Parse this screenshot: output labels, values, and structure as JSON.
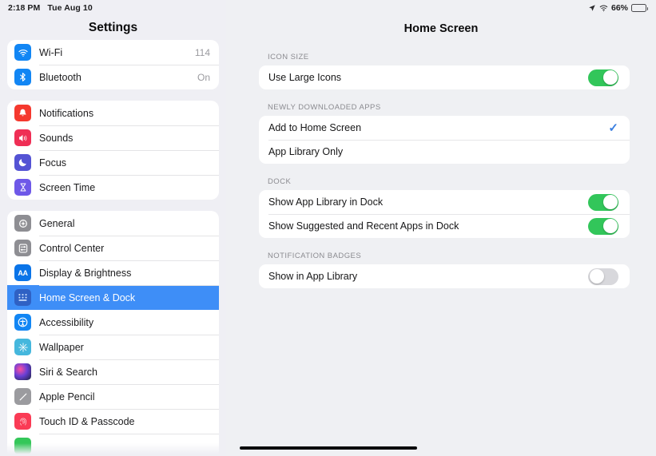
{
  "status_bar": {
    "time": "2:18 PM",
    "date": "Tue Aug 10",
    "battery_percent": "66%",
    "battery_level": 66,
    "charging": true,
    "location_icon": "location-arrow-icon",
    "wifi_icon": "wifi-icon",
    "battery_icon": "battery-charging-icon"
  },
  "sidebar": {
    "title": "Settings",
    "groups": [
      {
        "items": [
          {
            "label": "Wi-Fi",
            "value": "114",
            "icon": "wifi-icon",
            "selected": false
          },
          {
            "label": "Bluetooth",
            "value": "On",
            "icon": "bluetooth-icon",
            "selected": false
          }
        ]
      },
      {
        "items": [
          {
            "label": "Notifications",
            "value": "",
            "icon": "bell-icon",
            "selected": false
          },
          {
            "label": "Sounds",
            "value": "",
            "icon": "speaker-icon",
            "selected": false
          },
          {
            "label": "Focus",
            "value": "",
            "icon": "moon-icon",
            "selected": false
          },
          {
            "label": "Screen Time",
            "value": "",
            "icon": "hourglass-icon",
            "selected": false
          }
        ]
      },
      {
        "items": [
          {
            "label": "General",
            "value": "",
            "icon": "gear-icon",
            "selected": false
          },
          {
            "label": "Control Center",
            "value": "",
            "icon": "sliders-icon",
            "selected": false
          },
          {
            "label": "Display & Brightness",
            "value": "",
            "icon": "aa-text-icon",
            "selected": false
          },
          {
            "label": "Home Screen & Dock",
            "value": "",
            "icon": "app-grid-icon",
            "selected": true
          },
          {
            "label": "Accessibility",
            "value": "",
            "icon": "accessibility-icon",
            "selected": false
          },
          {
            "label": "Wallpaper",
            "value": "",
            "icon": "flower-icon",
            "selected": false
          },
          {
            "label": "Siri & Search",
            "value": "",
            "icon": "siri-orb-icon",
            "selected": false
          },
          {
            "label": "Apple Pencil",
            "value": "",
            "icon": "pencil-icon",
            "selected": false
          },
          {
            "label": "Touch ID & Passcode",
            "value": "",
            "icon": "fingerprint-icon",
            "selected": false
          }
        ]
      }
    ]
  },
  "main": {
    "title": "Home Screen",
    "sections": [
      {
        "header": "ICON SIZE",
        "rows": [
          {
            "label": "Use Large Icons",
            "control": "toggle",
            "state": "on"
          }
        ]
      },
      {
        "header": "NEWLY DOWNLOADED APPS",
        "rows": [
          {
            "label": "Add to Home Screen",
            "control": "check",
            "state": "checked"
          },
          {
            "label": "App Library Only",
            "control": "check",
            "state": "unchecked"
          }
        ]
      },
      {
        "header": "DOCK",
        "rows": [
          {
            "label": "Show App Library in Dock",
            "control": "toggle",
            "state": "on"
          },
          {
            "label": "Show Suggested and Recent Apps in Dock",
            "control": "toggle",
            "state": "on"
          }
        ]
      },
      {
        "header": "NOTIFICATION BADGES",
        "rows": [
          {
            "label": "Show in App Library",
            "control": "toggle",
            "state": "off"
          }
        ]
      }
    ],
    "checkmark_glyph": "✓"
  },
  "colors": {
    "accent_blue": "#3e8ef7",
    "toggle_on_green": "#32c65a",
    "toggle_off_gray": "#d8d8dc",
    "check_blue": "#3b7fe0",
    "page_bg": "#eff0f3",
    "sidebar_bg": "#efeff4"
  }
}
